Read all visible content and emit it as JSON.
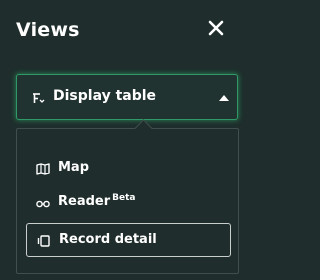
{
  "panel": {
    "title": "Views",
    "close_icon": "close-icon"
  },
  "dropdown": {
    "label": "Display table",
    "icon": "table-filter-icon",
    "caret_icon": "caret-up-icon",
    "state": "expanded"
  },
  "menu": {
    "items": [
      {
        "label": "Map",
        "badge": "",
        "icon": "map-icon",
        "selected": false
      },
      {
        "label": "Reader",
        "badge": "Beta",
        "icon": "glasses-icon",
        "selected": false
      },
      {
        "label": "Record detail",
        "badge": "",
        "icon": "record-detail-icon",
        "selected": true
      }
    ]
  },
  "colors": {
    "background": "#1f2e2c",
    "accent_glow": "#2f9a68",
    "text": "#ffffff",
    "menu_border": "#3f4f4c",
    "selected_border": "#c8cfcd"
  }
}
